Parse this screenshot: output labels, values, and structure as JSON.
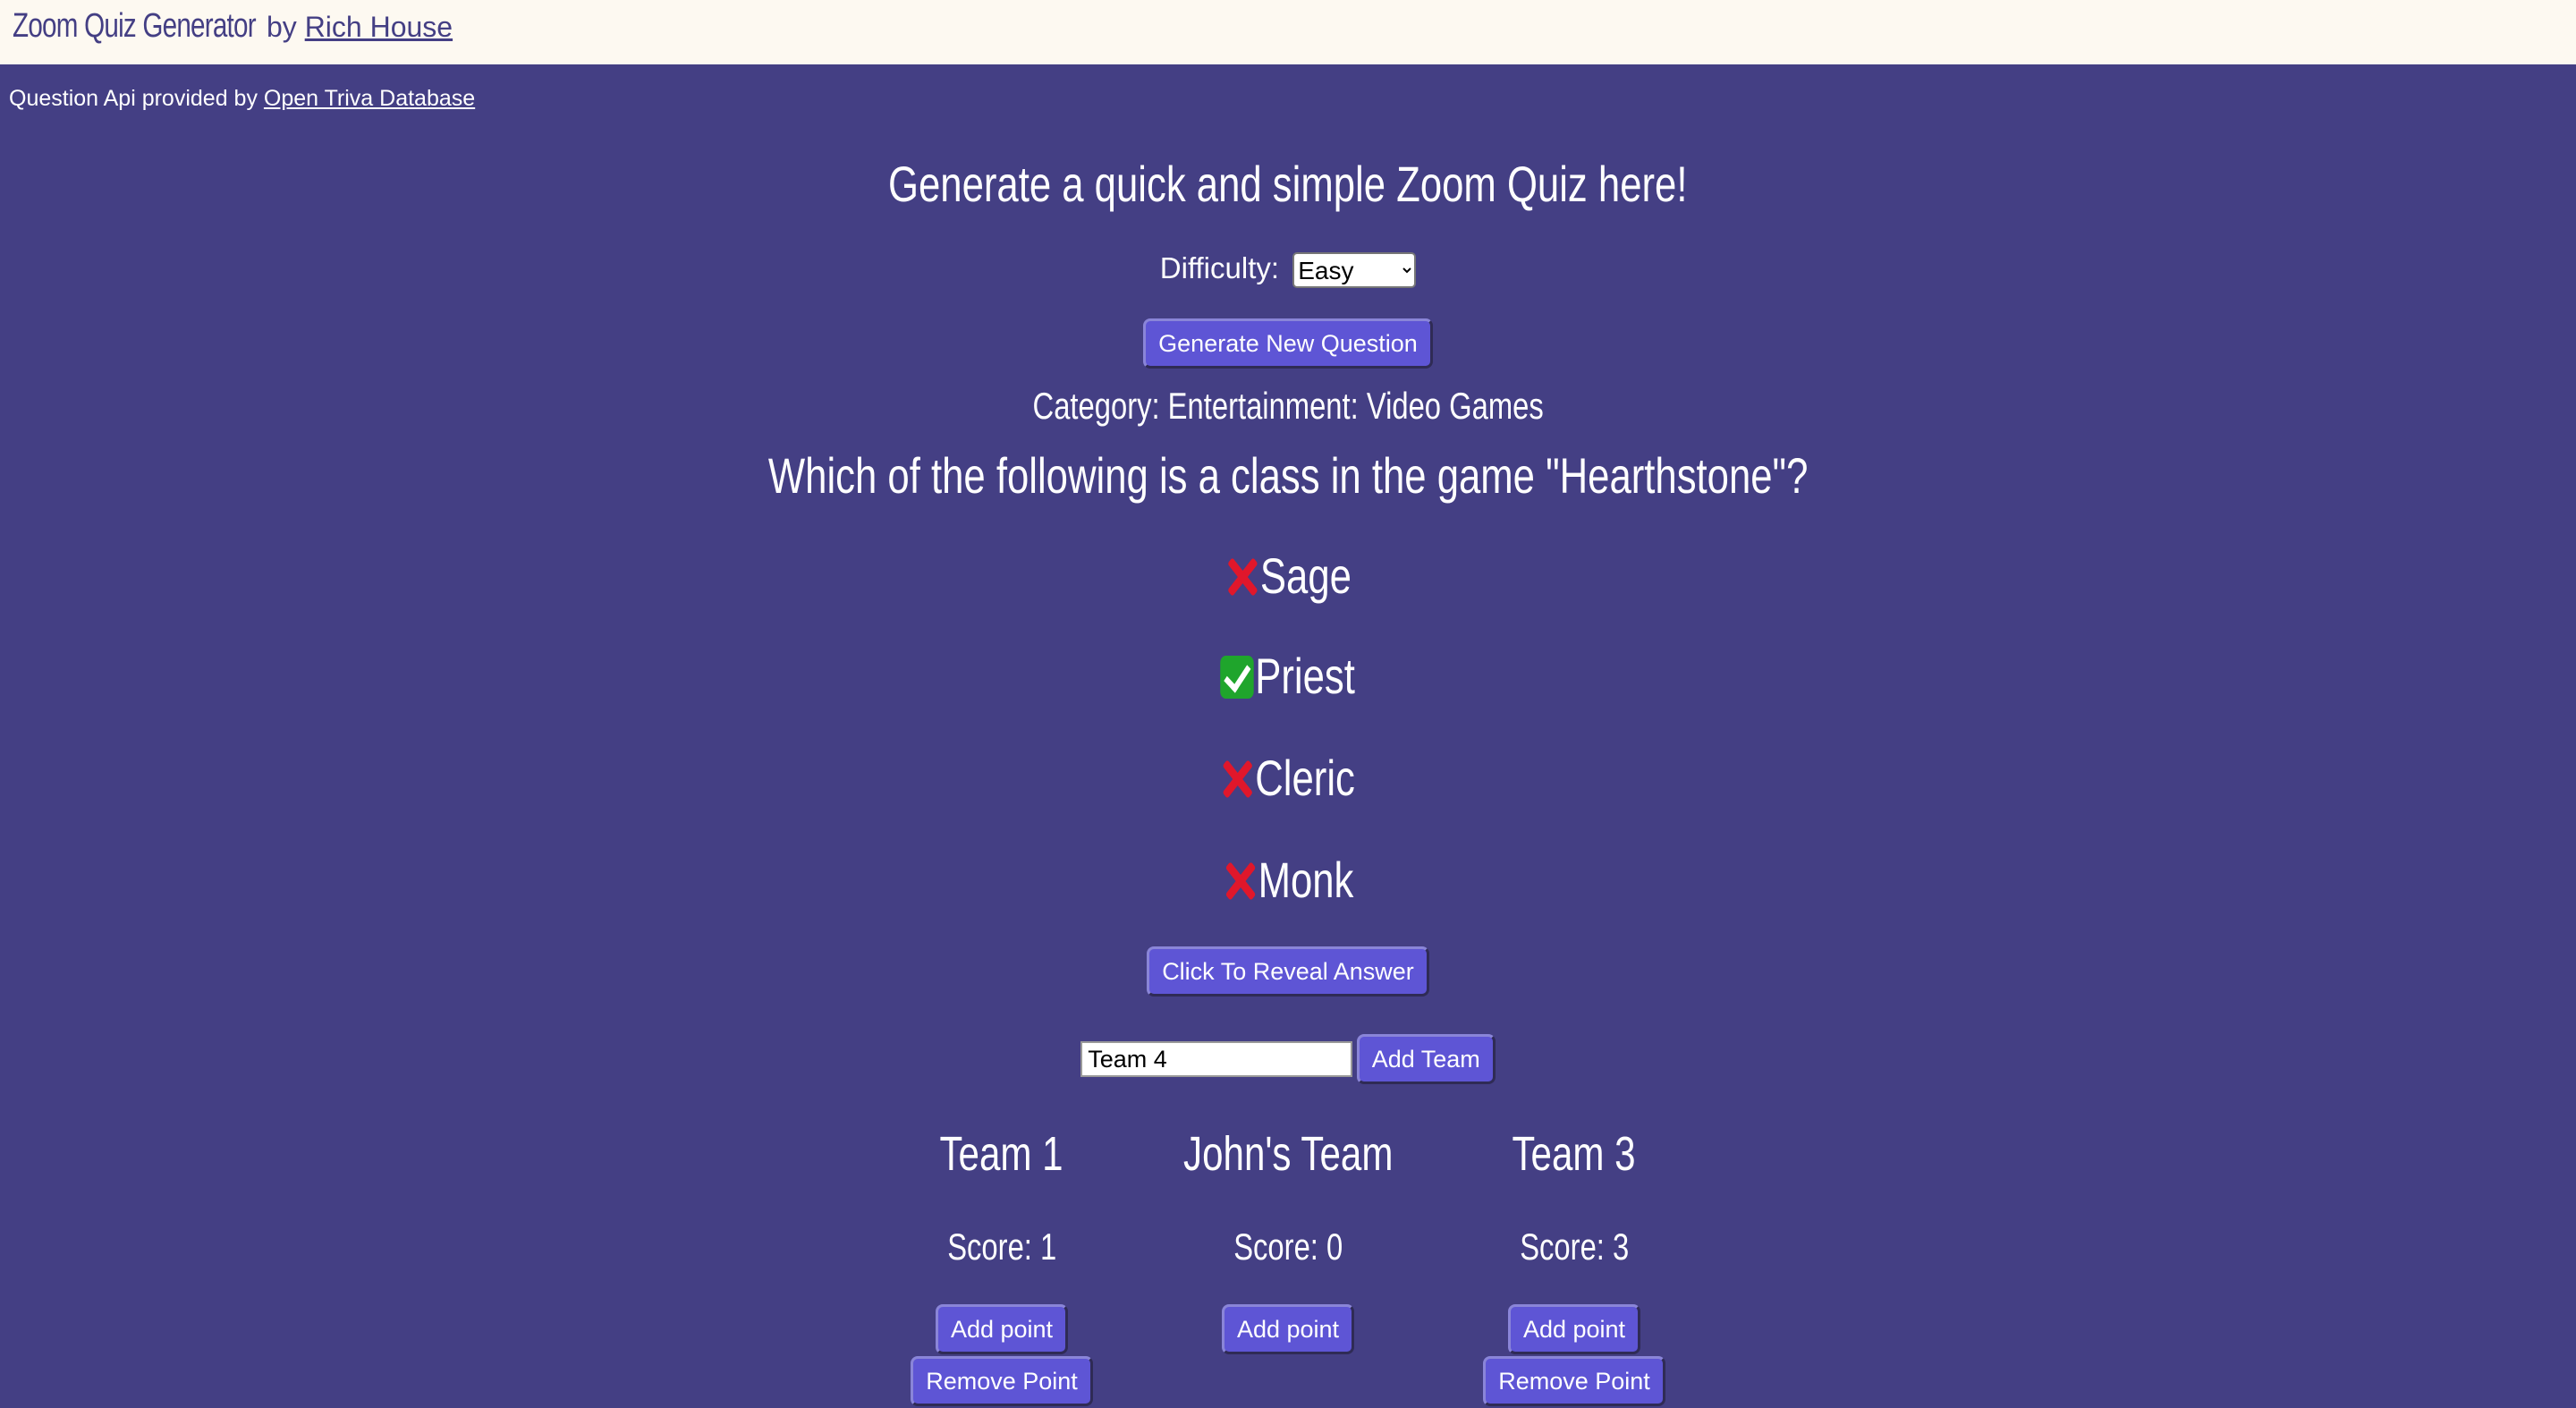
{
  "header": {
    "title": "Zoom Quiz Generator",
    "by_label": "by",
    "author": "Rich House"
  },
  "attribution": {
    "prefix": "Question Api provided by",
    "link": "Open Triva Database"
  },
  "main": {
    "headline": "Generate a quick and simple Zoom Quiz here!",
    "difficulty_label": "Difficulty:",
    "difficulty_selected": "Easy",
    "generate_button": "Generate New Question",
    "category": "Category: Entertainment: Video Games",
    "question": "Which of the following is a class in the game \"Hearthstone\"?",
    "answers": [
      {
        "text": "Sage",
        "correct": false,
        "icon": "cross-mark-icon"
      },
      {
        "text": "Priest",
        "correct": true,
        "icon": "check-mark-icon"
      },
      {
        "text": "Cleric",
        "correct": false,
        "icon": "cross-mark-icon"
      },
      {
        "text": "Monk",
        "correct": false,
        "icon": "cross-mark-icon"
      }
    ],
    "reveal_button": "Click To Reveal Answer",
    "team_input_value": "Team 4",
    "add_team_button": "Add Team"
  },
  "teams": [
    {
      "name": "Team 1",
      "score": "Score: 1",
      "add_label": "Add point",
      "remove_label": "Remove Point"
    },
    {
      "name": "John's Team",
      "score": "Score: 0",
      "add_label": "Add point",
      "remove_label": ""
    },
    {
      "name": "Team 3",
      "score": "Score: 3",
      "add_label": "Add point",
      "remove_label": "Remove Point"
    }
  ],
  "colors": {
    "background": "#443f84",
    "header_bg": "#fdf9f1",
    "button": "#5e55d5",
    "correct": "#1fa52c",
    "incorrect": "#e0172b"
  }
}
